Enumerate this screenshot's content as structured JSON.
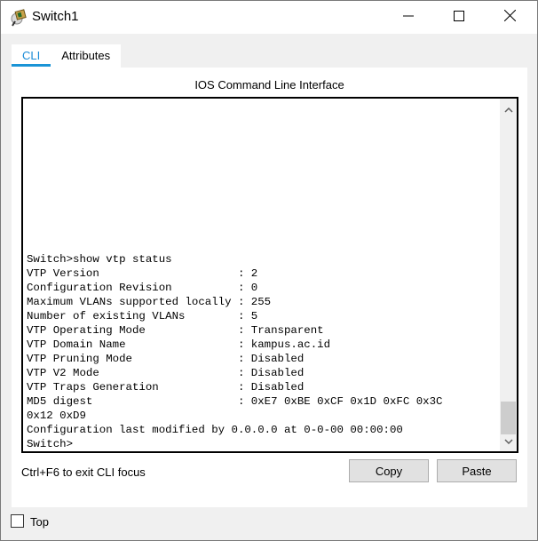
{
  "window": {
    "title": "Switch1",
    "icon": "switch-device-icon",
    "controls": [
      "minimize-icon",
      "maximize-icon",
      "close-icon"
    ]
  },
  "tabs": [
    {
      "label": "CLI",
      "active": true
    },
    {
      "label": "Attributes",
      "active": false
    }
  ],
  "panel": {
    "title": "IOS Command Line Interface"
  },
  "terminal": {
    "lines": [
      "Switch>show vtp status",
      "VTP Version                     : 2",
      "Configuration Revision          : 0",
      "Maximum VLANs supported locally : 255",
      "Number of existing VLANs        : 5",
      "VTP Operating Mode              : Transparent",
      "VTP Domain Name                 : kampus.ac.id",
      "VTP Pruning Mode                : Disabled",
      "VTP V2 Mode                     : Disabled",
      "VTP Traps Generation            : Disabled",
      "MD5 digest                      : 0xE7 0xBE 0xCF 0x1D 0xFC 0x3C",
      "0x12 0xD9",
      "Configuration last modified by 0.0.0.0 at 0-0-00 00:00:00",
      "Switch>"
    ],
    "scroll_position_percent": 100
  },
  "footer": {
    "hint": "Ctrl+F6 to exit CLI focus",
    "copy_label": "Copy",
    "paste_label": "Paste"
  },
  "top_checkbox": {
    "label": "Top",
    "checked": false
  }
}
